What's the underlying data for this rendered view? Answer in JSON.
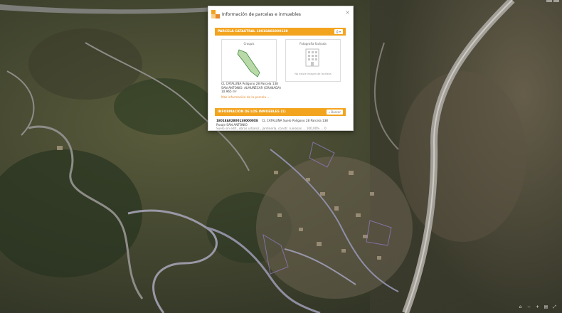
{
  "popup": {
    "title": "Información de parcelas e inmuebles",
    "close": "×",
    "parcel_header": "PARCELA CATASTRAL 18018A02800138",
    "sketch_label": "Croquis",
    "photo_label": "Fotografía fachada",
    "photo_caption": "No existe imagen de fachada",
    "address_lines": [
      "CL CATALUÑA Polígono 28 Parcela 138",
      "SAN ANTONIO. ALMUÑÉCAR (GRANADA)",
      "10.965 m²"
    ],
    "more_info": "Más información de la parcela",
    "properties_header": "INFORMACIÓN DE LOS INMUEBLES (1)",
    "properties_button": "Buscar",
    "property_ref": "18018A028001380000XE",
    "property_address": "CL CATALUÑA Suelo Polígono 28 Parcela 138",
    "property_place": "Paraje SAN ANTONIO",
    "property_use": "Suelo sin edif., obras urbaniz., jardinería, constr. ruinosas ... 100,00% ... 0"
  },
  "colors": {
    "accent": "#f3a41f",
    "link": "#e8882a"
  },
  "icons": [
    "catastro-logo-icon",
    "close-icon",
    "print-icon",
    "building-photo-icon"
  ]
}
